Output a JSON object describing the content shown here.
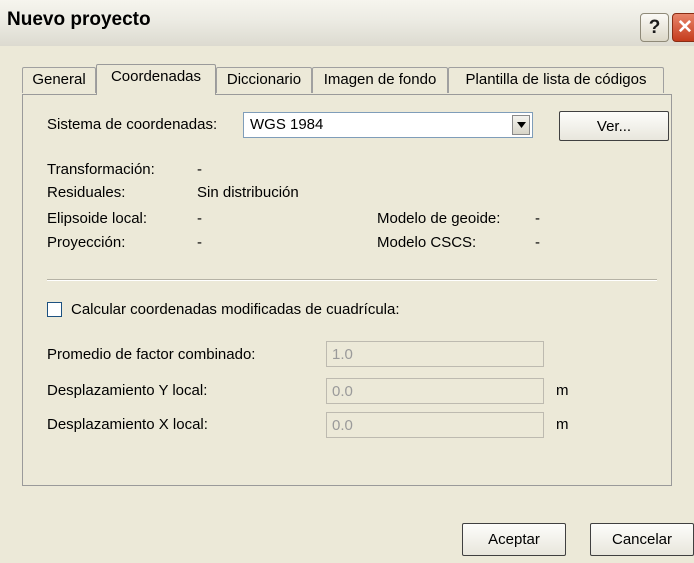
{
  "window": {
    "title": "Nuevo proyecto",
    "help_glyph": "?",
    "close_glyph": "✕"
  },
  "tabs": [
    {
      "label": "General",
      "active": false
    },
    {
      "label": "Coordenadas",
      "active": true
    },
    {
      "label": "Diccionario",
      "active": false
    },
    {
      "label": "Imagen de fondo",
      "active": false
    },
    {
      "label": "Plantilla de lista de códigos",
      "active": false
    }
  ],
  "coordinates": {
    "system_label": "Sistema de coordenadas:",
    "system_value": "WGS 1984",
    "view_button": "Ver...",
    "transformation_label": "Transformación:",
    "transformation_value": "-",
    "residuals_label": "Residuales:",
    "residuals_value": "Sin distribución",
    "local_ellipsoid_label": "Elipsoide local:",
    "local_ellipsoid_value": "-",
    "geoid_model_label": "Modelo de geoide:",
    "geoid_model_value": "-",
    "projection_label": "Proyección:",
    "projection_value": "-",
    "cscs_model_label": "Modelo CSCS:",
    "cscs_model_value": "-"
  },
  "grid": {
    "checkbox_label": "Calcular coordenadas modificadas de cuadrícula:",
    "checked": false,
    "combined_factor_label": "Promedio de factor combinado:",
    "combined_factor_value": "1.0",
    "local_y_label": "Desplazamiento Y local:",
    "local_y_value": "0.0",
    "local_y_unit": "m",
    "local_x_label": "Desplazamiento X local:",
    "local_x_value": "0.0",
    "local_x_unit": "m"
  },
  "footer": {
    "accept_label": "Aceptar",
    "cancel_label": "Cancelar"
  }
}
